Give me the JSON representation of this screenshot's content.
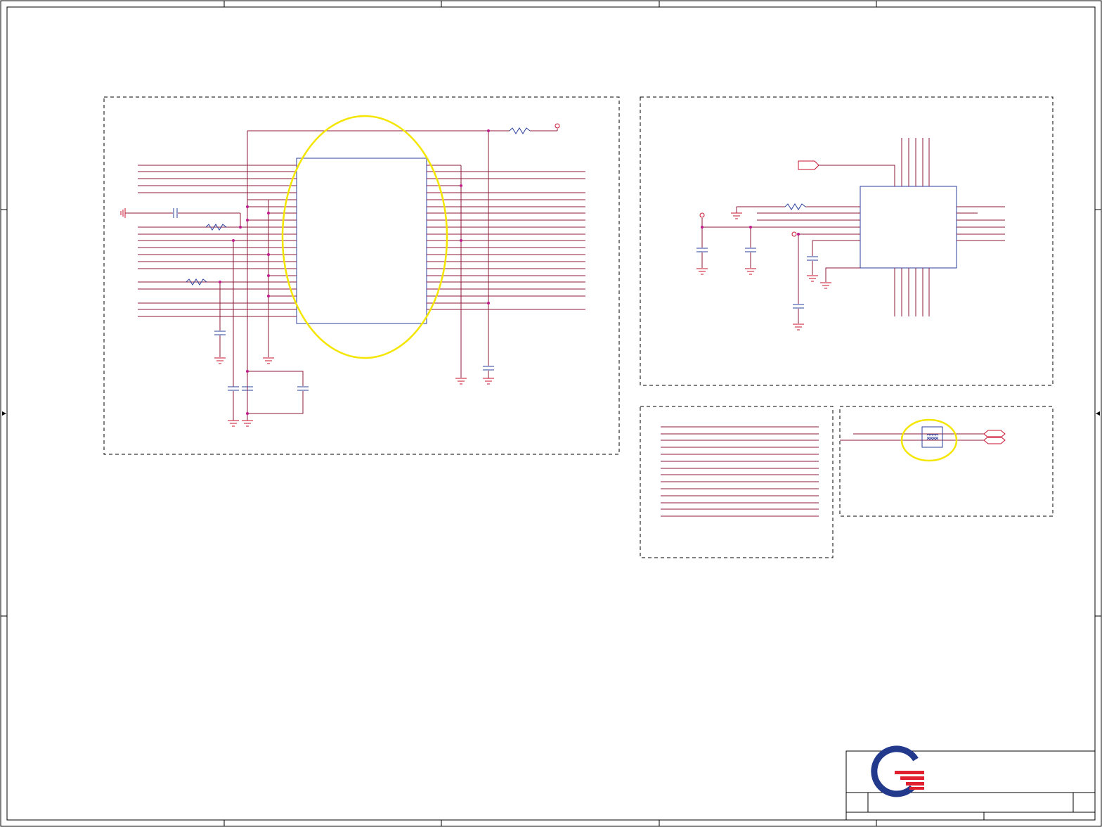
{
  "sheet": {
    "type": "schematic",
    "colors": {
      "wire": "#8b1a3a",
      "power": "#c8102e",
      "component": "#2b3f9e",
      "highlight": "#f4e600",
      "junction": "#c01c8c"
    }
  },
  "title_block": {
    "logo_icon": "company-logo-icon",
    "logo_colors": [
      "#233a8c",
      "#e0202e"
    ]
  }
}
